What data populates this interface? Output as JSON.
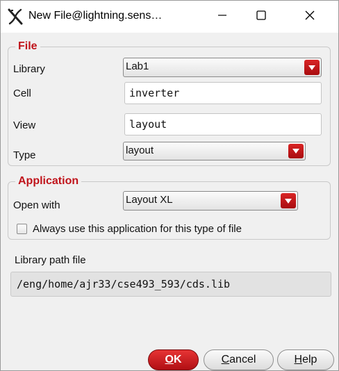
{
  "window": {
    "title": "New File@lightning.sens…",
    "app_icon": "x-logo-icon",
    "controls": {
      "minimize": "minimize-icon",
      "maximize": "maximize-icon",
      "close": "close-icon"
    }
  },
  "file_group": {
    "title": "File",
    "library": {
      "label": "Library",
      "value": "Lab1"
    },
    "cell": {
      "label": "Cell",
      "value": "inverter"
    },
    "view": {
      "label": "View",
      "value": "layout"
    },
    "type": {
      "label": "Type",
      "value": "layout"
    }
  },
  "application_group": {
    "title": "Application",
    "open_with": {
      "label": "Open with",
      "value": "Layout XL"
    },
    "always_use": {
      "label": "Always use this application for this type of file",
      "checked": false
    }
  },
  "library_path": {
    "label": "Library path file",
    "value": "/eng/home/ajr33/cse493_593/cds.lib"
  },
  "buttons": {
    "ok": {
      "first": "O",
      "rest": "K"
    },
    "cancel": {
      "first": "C",
      "rest": "ancel"
    },
    "help": {
      "first": "H",
      "rest": "elp"
    }
  },
  "colors": {
    "accent": "#c0141b",
    "dropdown_arrow": "#c3161c"
  }
}
